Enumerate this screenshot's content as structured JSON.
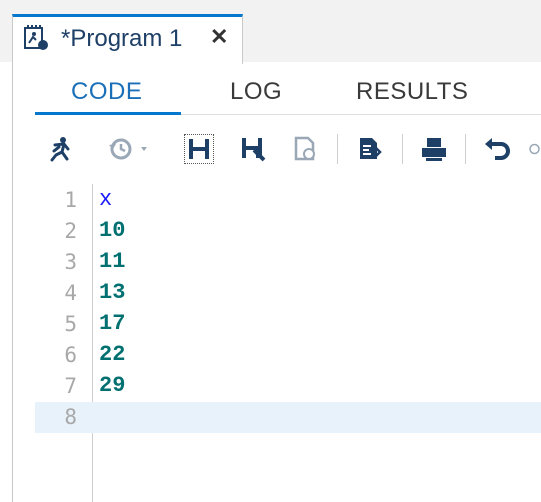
{
  "window": {
    "tab_title": "*Program 1",
    "tab_close": "✕"
  },
  "subtabs": [
    {
      "label": "CODE",
      "active": true
    },
    {
      "label": "LOG",
      "active": false
    },
    {
      "label": "RESULTS",
      "active": false
    }
  ],
  "toolbar": {
    "icons": [
      "run-icon",
      "history-icon",
      "save-icon",
      "save-as-icon",
      "export-icon",
      "format-code-icon",
      "print-icon",
      "undo-icon",
      "redo-icon"
    ]
  },
  "editor": {
    "lines": [
      {
        "num": "1",
        "text": "x",
        "kind": "var"
      },
      {
        "num": "2",
        "text": "10",
        "kind": "num"
      },
      {
        "num": "3",
        "text": "11",
        "kind": "num"
      },
      {
        "num": "4",
        "text": "13",
        "kind": "num"
      },
      {
        "num": "5",
        "text": "17",
        "kind": "num"
      },
      {
        "num": "6",
        "text": "22",
        "kind": "num"
      },
      {
        "num": "7",
        "text": "29",
        "kind": "num"
      },
      {
        "num": "8",
        "text": "",
        "kind": "current"
      }
    ]
  },
  "colors": {
    "accent": "#0378cd",
    "variable": "#1a1aff",
    "number": "#007070",
    "current_line": "#e8f2fb"
  }
}
